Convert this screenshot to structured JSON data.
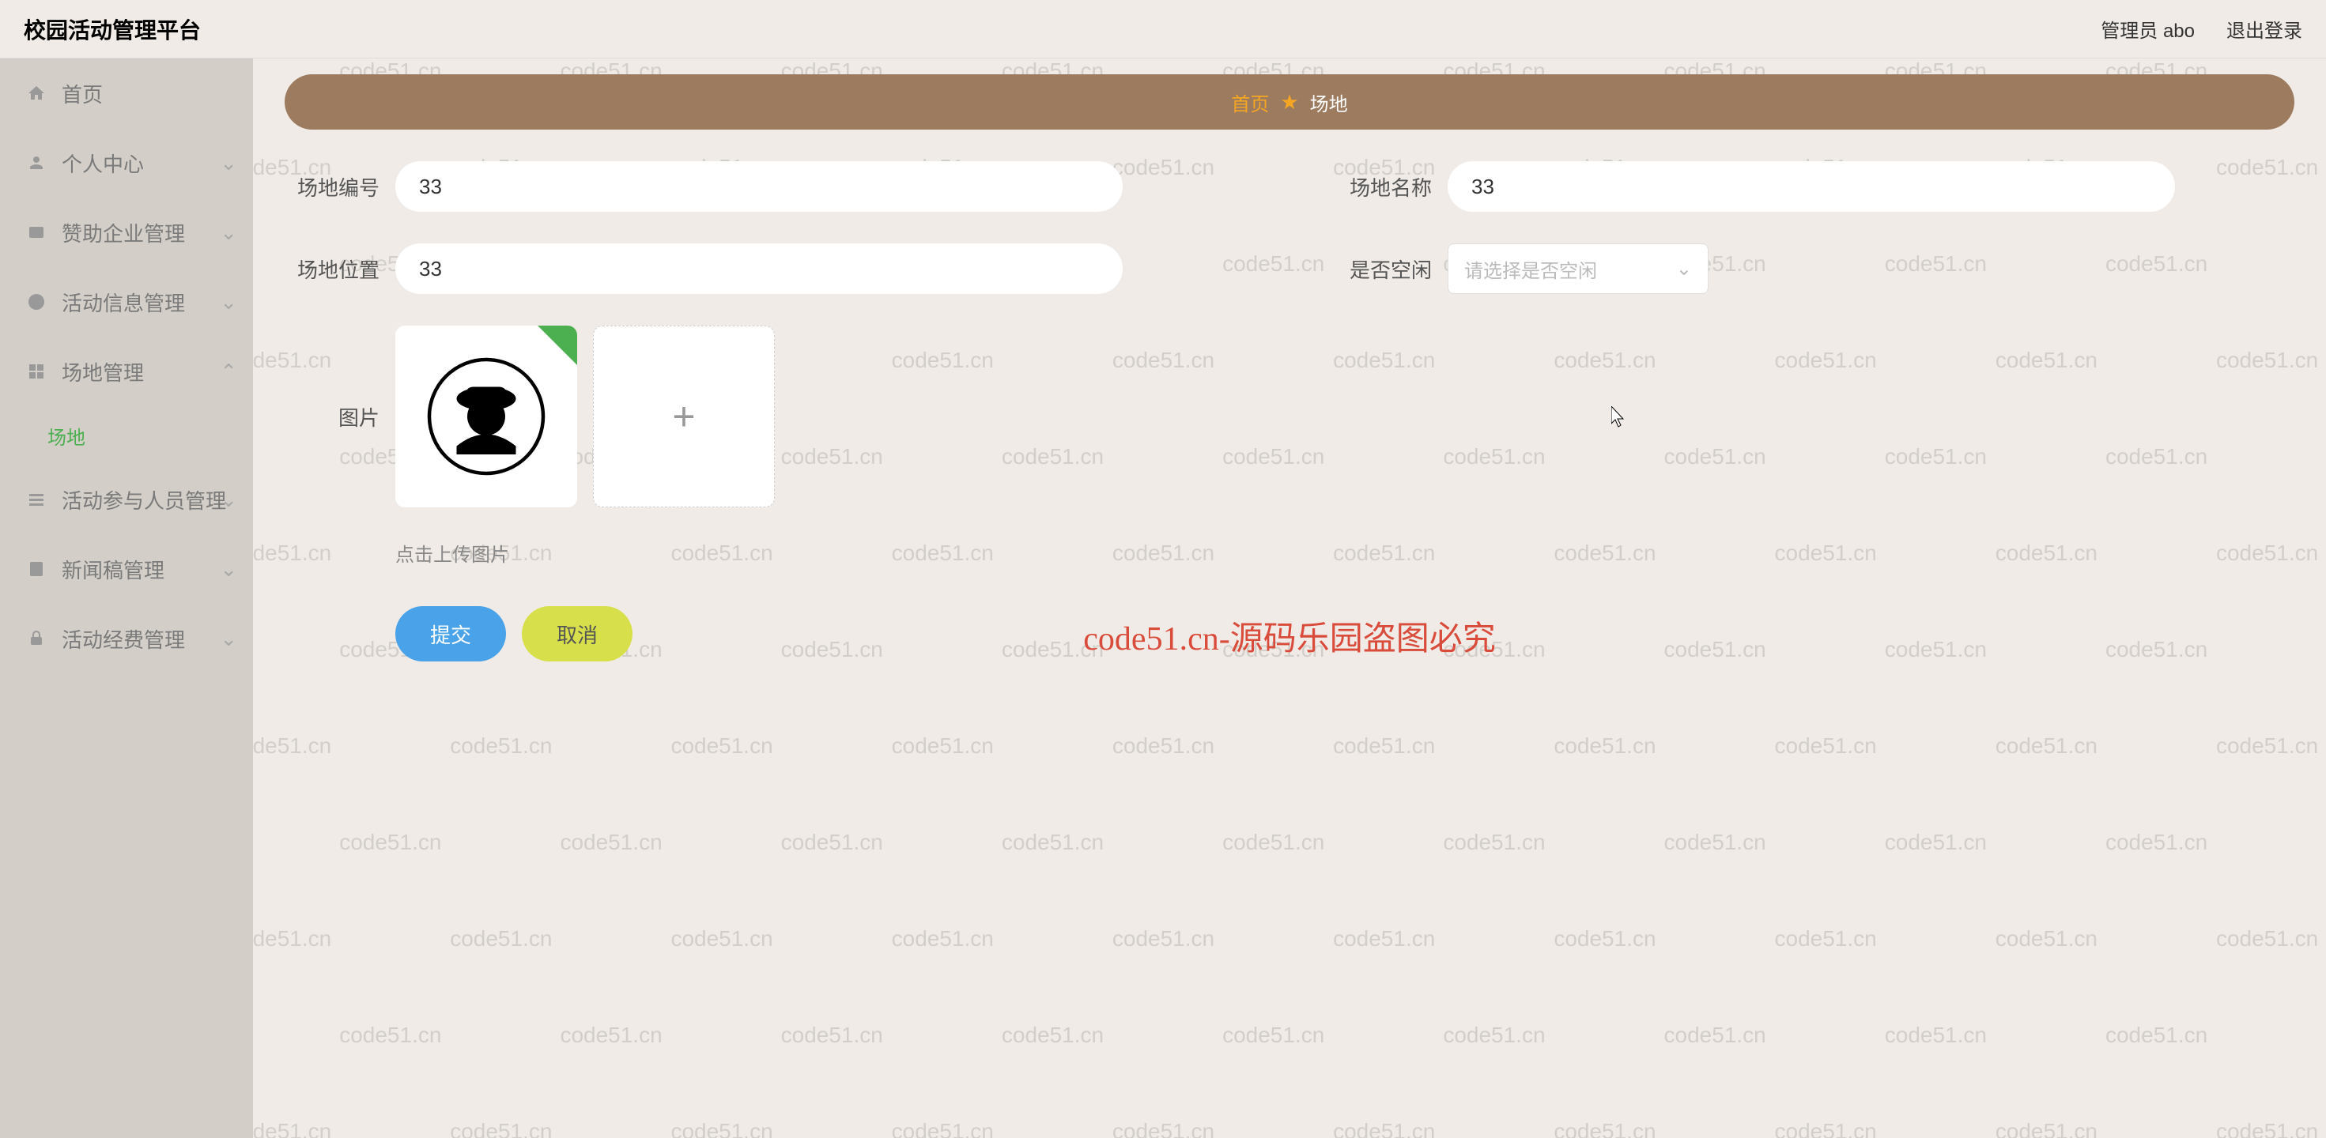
{
  "header": {
    "title": "校园活动管理平台",
    "user_label": "管理员 abo",
    "logout_label": "退出登录"
  },
  "sidebar": {
    "items": [
      {
        "label": "首页"
      },
      {
        "label": "个人中心"
      },
      {
        "label": "赞助企业管理"
      },
      {
        "label": "活动信息管理"
      },
      {
        "label": "场地管理",
        "expanded": true,
        "children": [
          {
            "label": "场地"
          }
        ]
      },
      {
        "label": "活动参与人员管理"
      },
      {
        "label": "新闻稿管理"
      },
      {
        "label": "活动经费管理"
      }
    ]
  },
  "breadcrumb": {
    "home": "首页",
    "current": "场地"
  },
  "form": {
    "field1_label": "场地编号",
    "field1_value": "33",
    "field2_label": "场地名称",
    "field2_value": "33",
    "field3_label": "场地位置",
    "field3_value": "33",
    "field4_label": "是否空闲",
    "field4_placeholder": "请选择是否空闲",
    "image_label": "图片",
    "upload_hint": "点击上传图片",
    "submit_label": "提交",
    "cancel_label": "取消"
  },
  "watermark_text": "code51.cn",
  "warning_text": "code51.cn-源码乐园盗图必究"
}
